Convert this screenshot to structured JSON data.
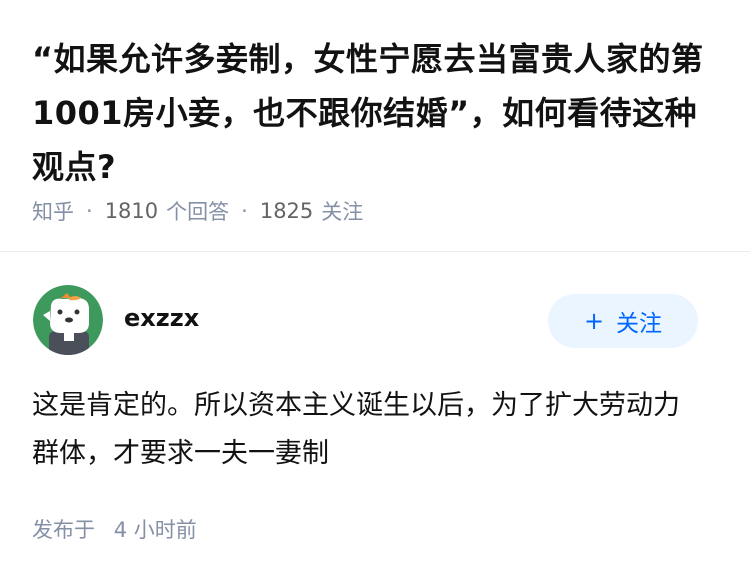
{
  "question": {
    "title": "“如果允许多妾制，女性宁愿去当富贵人家的第1001房小妾，也不跟你结婚”，如何看待这种观点?",
    "source": "知乎",
    "answers_count": "1810",
    "answers_label": "个回答",
    "followers_count": "1825",
    "followers_label": "关注",
    "separator": "·"
  },
  "answer": {
    "author": {
      "name": "exzzx",
      "avatar_icon": "avatar-cartoon-dog-icon",
      "avatar_bg_color": "#3d9a5c"
    },
    "follow_button": {
      "icon": "+",
      "label": "关注",
      "bg_color": "#ebf5ff",
      "text_color": "#0066ff"
    },
    "content": "这是肯定的。所以资本主义诞生以后，为了扩大劳动力群体，才要求一夫一妻制",
    "publish_label": "发布于",
    "publish_time": "4 小时前"
  }
}
